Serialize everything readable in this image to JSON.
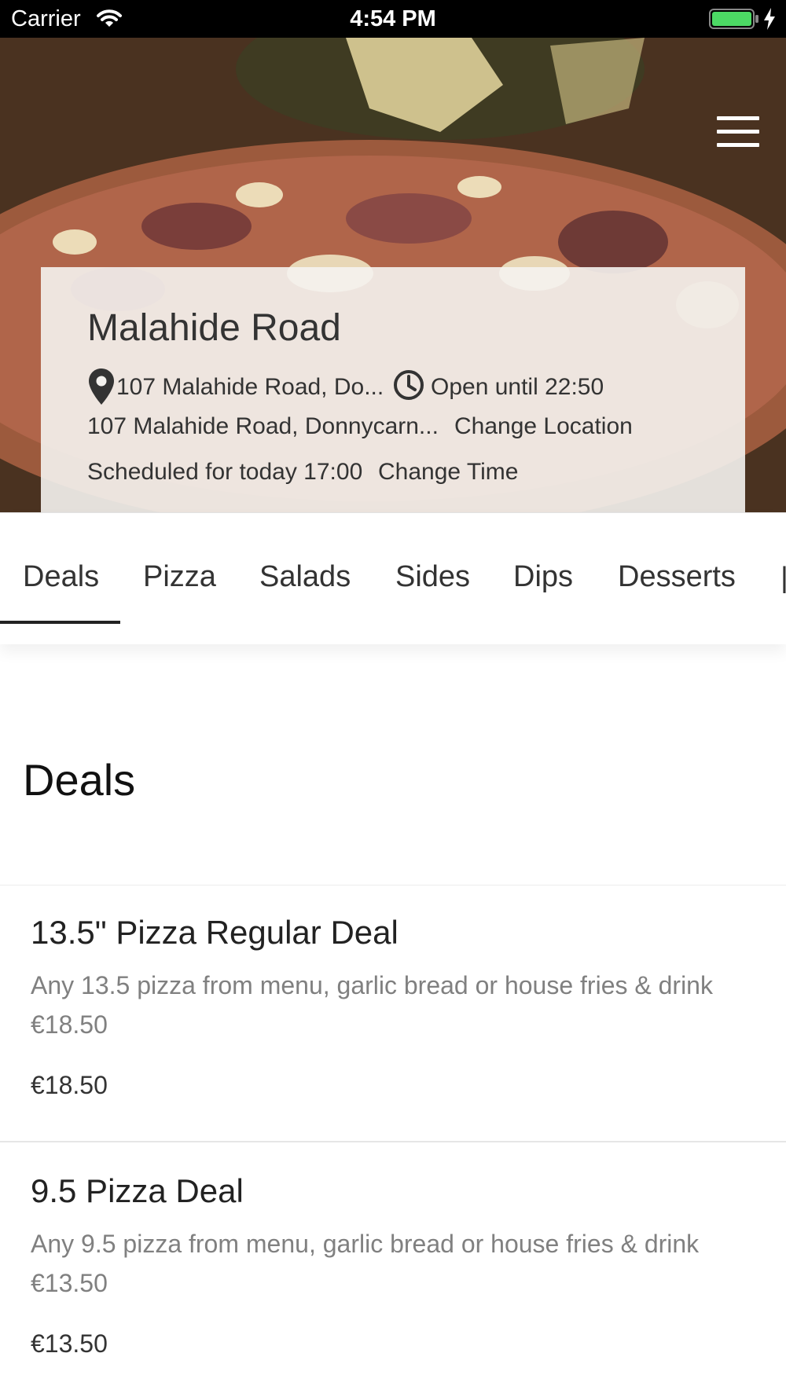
{
  "status_bar": {
    "carrier": "Carrier",
    "time": "4:54 PM"
  },
  "hero": {
    "image": "pizza-photo"
  },
  "location": {
    "name": "Malahide Road",
    "address_short": "107 Malahide Road, Do...",
    "open_until": "Open until 22:50",
    "address_long": "107 Malahide Road, Donnycarn...",
    "change_location": "Change Location",
    "scheduled": "Scheduled for today 17:00",
    "change_time": "Change Time"
  },
  "tabs": [
    {
      "label": "Deals",
      "active": true
    },
    {
      "label": "Pizza"
    },
    {
      "label": "Salads"
    },
    {
      "label": "Sides"
    },
    {
      "label": "Dips"
    },
    {
      "label": "Desserts"
    }
  ],
  "section": {
    "title": "Deals"
  },
  "deals": [
    {
      "title": "13.5\" Pizza Regular Deal",
      "description": "Any 13.5 pizza from menu, garlic bread or house fries & drink €18.50",
      "price": "€18.50"
    },
    {
      "title": "9.5 Pizza Deal",
      "description": "Any 9.5 pizza from menu, garlic bread or house fries & drink €13.50",
      "price": "€13.50"
    }
  ],
  "colors": {
    "battery": "#4cd964",
    "tab_underline": "#222222",
    "status_bar": "#000000"
  },
  "icons": [
    "wifi-icon",
    "battery-icon",
    "bolt-icon",
    "menu-icon",
    "pin-icon",
    "clock-icon"
  ]
}
